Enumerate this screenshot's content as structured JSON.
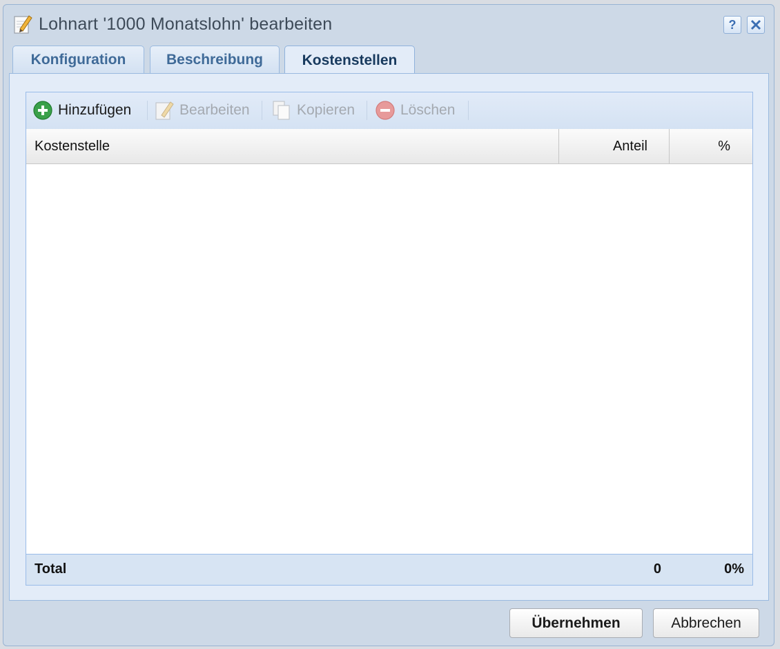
{
  "window": {
    "title": "Lohnart '1000 Monatslohn' bearbeiten",
    "help_symbol": "?",
    "close_symbol": "✕"
  },
  "tabs": [
    {
      "label": "Konfiguration",
      "active": false
    },
    {
      "label": "Beschreibung",
      "active": false
    },
    {
      "label": "Kostenstellen",
      "active": true
    }
  ],
  "toolbar": {
    "add_label": "Hinzufügen",
    "edit_label": "Bearbeiten",
    "copy_label": "Kopieren",
    "delete_label": "Löschen"
  },
  "grid": {
    "columns": [
      "Kostenstelle",
      "Anteil",
      "%"
    ],
    "rows": [],
    "summary": {
      "label": "Total",
      "anteil": "0",
      "percent": "0%"
    }
  },
  "buttons": {
    "apply_label": "Übernehmen",
    "cancel_label": "Abbrechen"
  },
  "colors": {
    "accent": "#3b6eb3",
    "add_green": "#3aa04a",
    "delete_red": "#e08a8a"
  }
}
